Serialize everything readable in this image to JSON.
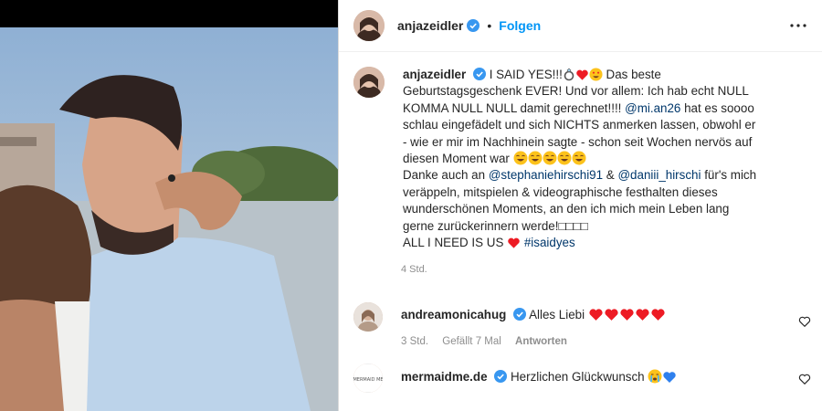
{
  "post": {
    "author": "anjazeidler",
    "dot": "•",
    "follow_label": "Folgen",
    "caption": {
      "author": "anjazeidler",
      "line1": "I SAID YES!!!",
      "line1_after": " Das beste",
      "line2": "Geburtstagsgeschenk EVER! Und vor allem: Ich hab echt NULL",
      "line3": "KOMMA NULL NULL damit gerechnet!!!! ",
      "mention1": "@mi.an26",
      "line3_after": " hat es soooo",
      "line4": "schlau eingefädelt und sich NICHTS anmerken lassen, obwohl er",
      "line5": "- wie er mir im Nachhinein sagte - schon seit Wochen nervös auf",
      "line6": "diesen Moment war",
      "line7_before": "Danke auch an ",
      "mention2": "@stephaniehirschi91",
      "amp": " & ",
      "mention3": "@daniii_hirschi",
      "line7_after": " für's mich",
      "line8": "veräppeln, mitspielen & videographische festhalten dieses",
      "line9": "wunderschönen Moments, an den ich mich mein Leben lang",
      "line10": "gerne zurückerinnern werde!□□□□",
      "line11": "ALL I NEED IS US ",
      "hashtag": "#isaidyes"
    },
    "time": "4 Std."
  },
  "comments": [
    {
      "author": "andreamonicahug",
      "text": "Alles Liebi",
      "time": "3 Std.",
      "likes": "Gefällt 7 Mal",
      "reply": "Antworten"
    },
    {
      "author": "mermaidme.de",
      "text": "Herzlichen Glückwunsch"
    }
  ],
  "colors": {
    "link": "#0095f6",
    "mention": "#00376b",
    "heart": "#ed1b24",
    "meta": "#8e8e8e"
  },
  "icons": [
    "verified-icon",
    "more-options-icon",
    "heart-like-icon",
    "ring-emoji",
    "red-heart-emoji",
    "heart-eyes-emoji",
    "laughing-emoji",
    "crying-emoji",
    "blue-heart-emoji"
  ]
}
